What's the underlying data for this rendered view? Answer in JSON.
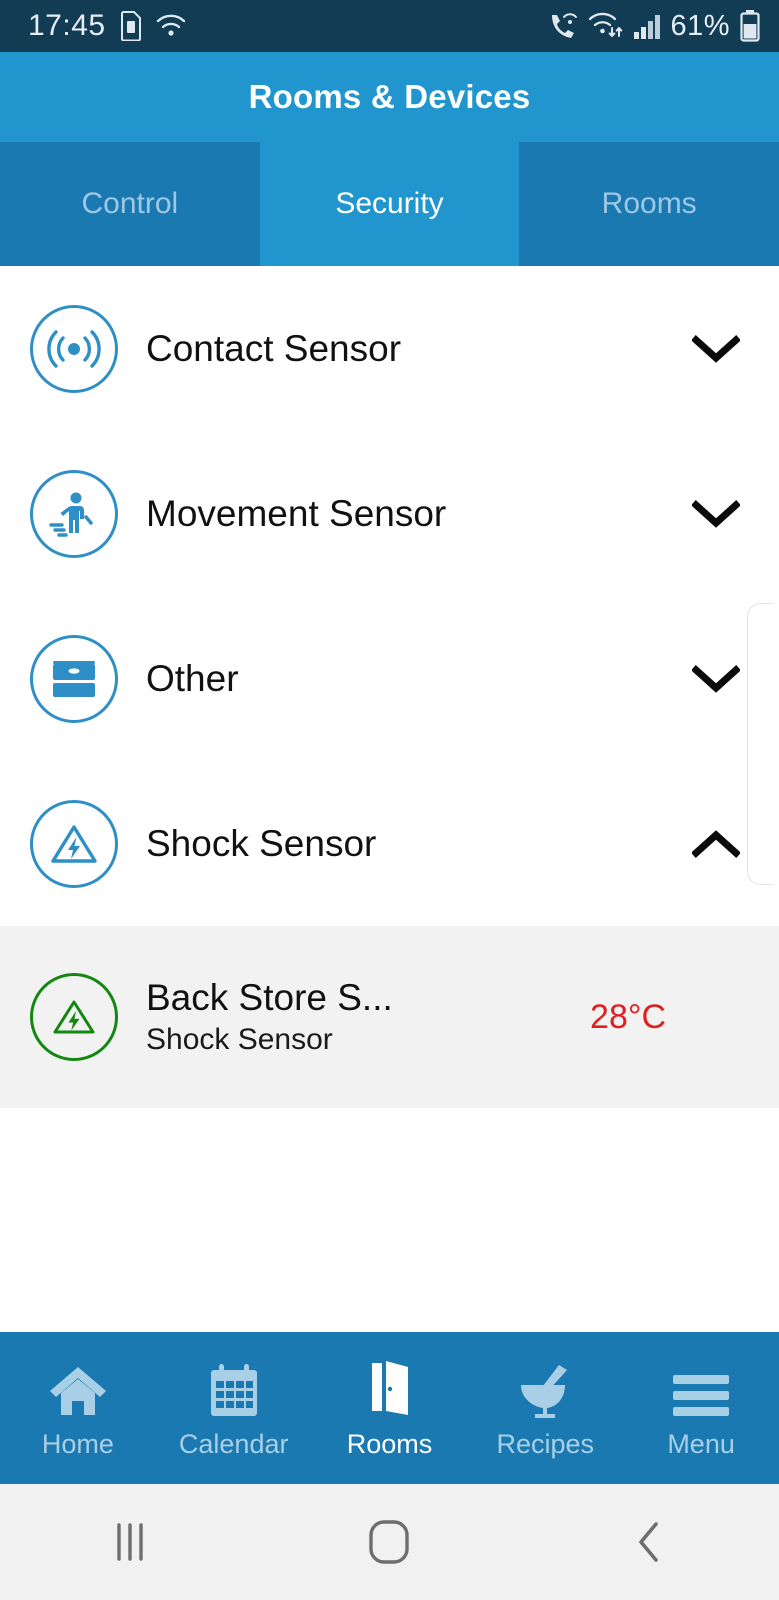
{
  "status_bar": {
    "time": "17:45",
    "battery_percent": "61%",
    "icons": [
      "sim-card-icon",
      "wifi-icon",
      "wifi-calling-icon",
      "wifi-data-icon",
      "signal-bars-icon",
      "battery-icon"
    ],
    "background": "#123C53"
  },
  "app_bar": {
    "title": "Rooms & Devices",
    "background": "#2196CE"
  },
  "tabs": {
    "active_index": 1,
    "items": [
      {
        "label": "Control"
      },
      {
        "label": "Security"
      },
      {
        "label": "Rooms"
      }
    ],
    "active_background": "#2196CE",
    "inactive_background": "#1A79B0"
  },
  "groups": [
    {
      "label": "Contact Sensor",
      "icon": "signal-waves-icon",
      "expanded": false,
      "chevron": "chevron-down-icon"
    },
    {
      "label": "Movement Sensor",
      "icon": "walking-person-icon",
      "expanded": false,
      "chevron": "chevron-down-icon"
    },
    {
      "label": "Other",
      "icon": "storage-box-icon",
      "expanded": false,
      "chevron": "chevron-down-icon"
    },
    {
      "label": "Shock Sensor",
      "icon": "shock-warning-icon",
      "expanded": true,
      "chevron": "chevron-up-icon"
    }
  ],
  "devices": [
    {
      "name": "Back Store S...",
      "type": "Shock Sensor",
      "value": "28°C",
      "value_color": "#E02020",
      "icon": "shock-warning-icon",
      "icon_color": "#138810",
      "row_background": "#F2F2F2"
    }
  ],
  "bottom_nav": {
    "active_index": 2,
    "items": [
      {
        "label": "Home",
        "icon": "house-icon"
      },
      {
        "label": "Calendar",
        "icon": "calendar-icon"
      },
      {
        "label": "Rooms",
        "icon": "open-door-icon"
      },
      {
        "label": "Recipes",
        "icon": "mortar-pestle-icon"
      },
      {
        "label": "Menu",
        "icon": "hamburger-menu-icon"
      }
    ],
    "background": "#1A79B0"
  },
  "android_nav": {
    "buttons": [
      {
        "icon": "recents-icon"
      },
      {
        "icon": "home-icon"
      },
      {
        "icon": "back-icon"
      }
    ],
    "background": "#F1F1F1"
  }
}
